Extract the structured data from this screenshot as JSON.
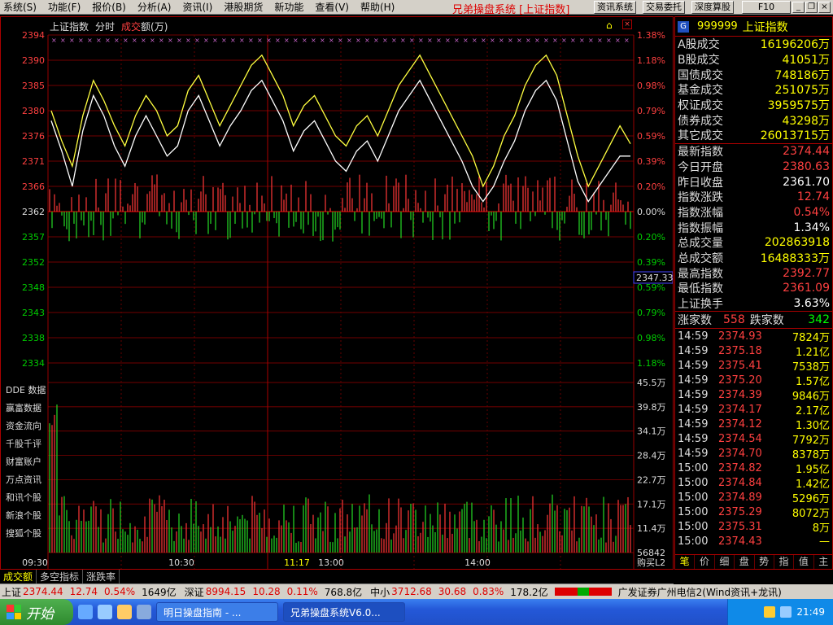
{
  "menu": [
    "系统(S)",
    "功能(F)",
    "报价(B)",
    "分析(A)",
    "资讯(I)",
    "港股期货",
    "新功能",
    "查看(V)",
    "帮助(H)"
  ],
  "app_title": "兄弟操盘系统 [上证指数]",
  "toolbar": {
    "b1": "资讯系统",
    "b2": "交易委托",
    "b3": "深度算股",
    "b4": "F10"
  },
  "chart_header": {
    "name": "上证指数",
    "mode": "分时",
    "ind1": "成交",
    "ind2": "额(万)"
  },
  "price_axis": [
    "2394",
    "2390",
    "2385",
    "2380",
    "2376",
    "2371",
    "2366",
    "2362",
    "2357",
    "2352",
    "2348",
    "2343",
    "2338",
    "2334"
  ],
  "pct_axis": [
    "1.38%",
    "1.18%",
    "0.98%",
    "0.79%",
    "0.59%",
    "0.39%",
    "0.20%",
    "0.00%",
    "0.20%",
    "0.39%",
    "0.59%",
    "0.79%",
    "0.98%",
    "1.18%"
  ],
  "vol_axis": [
    "45.5万",
    "39.8万",
    "34.1万",
    "28.4万",
    "22.7万",
    "17.1万",
    "11.4万",
    "56842"
  ],
  "current_price_label": "2347.33",
  "side_links": [
    "DDE 数据",
    "赢富数据",
    "资金流向",
    "千股千评",
    "财富账户",
    "万点资讯",
    "和讯个股",
    "新浪个股",
    "搜狐个股"
  ],
  "time_axis": [
    "09:30",
    "10:30",
    "11:17",
    "13:00",
    "14:00"
  ],
  "buy_label": "购买L2",
  "chart_data": {
    "type": "line",
    "series": [
      {
        "name": "上证指数",
        "values": [
          2381,
          2375,
          2370,
          2380,
          2387,
          2383,
          2378,
          2374,
          2380,
          2384,
          2381,
          2376,
          2378,
          2385,
          2388,
          2383,
          2378,
          2382,
          2386,
          2390,
          2392,
          2388,
          2384,
          2378,
          2382,
          2384,
          2380,
          2376,
          2374,
          2378,
          2380,
          2376,
          2381,
          2386,
          2389,
          2392,
          2388,
          2384,
          2380,
          2376,
          2372,
          2366,
          2370,
          2376,
          2380,
          2386,
          2390,
          2392,
          2388,
          2380,
          2372,
          2366,
          2370,
          2374,
          2378,
          2374.44
        ]
      },
      {
        "name": "",
        "values": [
          2379,
          2373,
          2366,
          2377,
          2384,
          2380,
          2374,
          2370,
          2376,
          2380,
          2376,
          2372,
          2374,
          2381,
          2384,
          2379,
          2374,
          2378,
          2381,
          2385,
          2387,
          2383,
          2379,
          2373,
          2377,
          2379,
          2375,
          2371,
          2369,
          2373,
          2375,
          2371,
          2376,
          2381,
          2384,
          2387,
          2383,
          2379,
          2375,
          2371,
          2366,
          2363,
          2366,
          2371,
          2375,
          2381,
          2385,
          2387,
          2383,
          2375,
          2367,
          2363,
          2366,
          2369,
          2372,
          2372
        ]
      }
    ],
    "ylim": [
      2331,
      2396
    ],
    "ylabel": ""
  },
  "stock": {
    "badge": "G",
    "code": "999999",
    "name": "上证指数"
  },
  "stats1": [
    {
      "label": "A股成交",
      "value": "16196206万"
    },
    {
      "label": "B股成交",
      "value": "41051万"
    },
    {
      "label": "国债成交",
      "value": "748186万"
    },
    {
      "label": "基金成交",
      "value": "251075万"
    },
    {
      "label": "权证成交",
      "value": "3959575万"
    },
    {
      "label": "债券成交",
      "value": "43298万"
    },
    {
      "label": "其它成交",
      "value": "26013715万"
    }
  ],
  "stats2": [
    {
      "label": "最新指数",
      "value": "2374.44",
      "color": "#ff4040"
    },
    {
      "label": "今日开盘",
      "value": "2380.63",
      "color": "#ff4040"
    },
    {
      "label": "昨日收盘",
      "value": "2361.70",
      "color": "#ffffff"
    },
    {
      "label": "指数涨跌",
      "value": "12.74",
      "color": "#ff4040"
    },
    {
      "label": "指数涨幅",
      "value": "0.54%",
      "color": "#ff4040"
    },
    {
      "label": "指数振幅",
      "value": "1.34%",
      "color": "#ffffff"
    },
    {
      "label": "总成交量",
      "value": "202863918",
      "color": "#ffff00"
    },
    {
      "label": "总成交额",
      "value": "16488333万",
      "color": "#ffff00"
    },
    {
      "label": "最高指数",
      "value": "2392.77",
      "color": "#ff4040"
    },
    {
      "label": "最低指数",
      "value": "2361.09",
      "color": "#ff4040"
    },
    {
      "label": "上证换手",
      "value": "3.63%",
      "color": "#ffffff"
    }
  ],
  "updown": {
    "up_label": "涨家数",
    "up": "558",
    "down_label": "跌家数",
    "down": "342"
  },
  "ticks": [
    {
      "t": "14:59",
      "p": "2374.93",
      "v": "7824万"
    },
    {
      "t": "14:59",
      "p": "2375.18",
      "v": "1.21亿"
    },
    {
      "t": "14:59",
      "p": "2375.41",
      "v": "7538万"
    },
    {
      "t": "14:59",
      "p": "2375.20",
      "v": "1.57亿"
    },
    {
      "t": "14:59",
      "p": "2374.39",
      "v": "9846万"
    },
    {
      "t": "14:59",
      "p": "2374.17",
      "v": "2.17亿"
    },
    {
      "t": "14:59",
      "p": "2374.12",
      "v": "1.30亿"
    },
    {
      "t": "14:59",
      "p": "2374.54",
      "v": "7792万"
    },
    {
      "t": "14:59",
      "p": "2374.70",
      "v": "8378万"
    },
    {
      "t": "15:00",
      "p": "2374.82",
      "v": "1.95亿"
    },
    {
      "t": "15:00",
      "p": "2374.84",
      "v": "1.42亿"
    },
    {
      "t": "15:00",
      "p": "2374.89",
      "v": "5296万"
    },
    {
      "t": "15:00",
      "p": "2375.29",
      "v": "8072万"
    },
    {
      "t": "15:00",
      "p": "2375.31",
      "v": "8万"
    },
    {
      "t": "15:00",
      "p": "2374.43",
      "v": "—"
    }
  ],
  "panel_tabs": [
    "笔",
    "价",
    "细",
    "盘",
    "势",
    "指",
    "值",
    "主"
  ],
  "bottom_tabs": [
    "成交额",
    "多空指标",
    "涨跌率"
  ],
  "statusbar": {
    "sh_label": "上证",
    "sh_price": "2374.44",
    "sh_chg": "12.74",
    "sh_pct": "0.54%",
    "sh_amt": "1649亿",
    "sz_label": "深证",
    "sz_price": "8994.15",
    "sz_chg": "10.28",
    "sz_pct": "0.11%",
    "sz_amt": "768.8亿",
    "zx_label": "中小",
    "zx_price": "3712.68",
    "zx_chg": "30.68",
    "zx_pct": "0.83%",
    "zx_amt": "178.2亿",
    "broker": "广发证券广州电信2(Wind资讯+龙讯)"
  },
  "taskbar": {
    "start": "开始",
    "task1": "明日操盘指南 - ...",
    "task2": "兄弟操盘系统V6.0...",
    "clock": "21:49"
  }
}
